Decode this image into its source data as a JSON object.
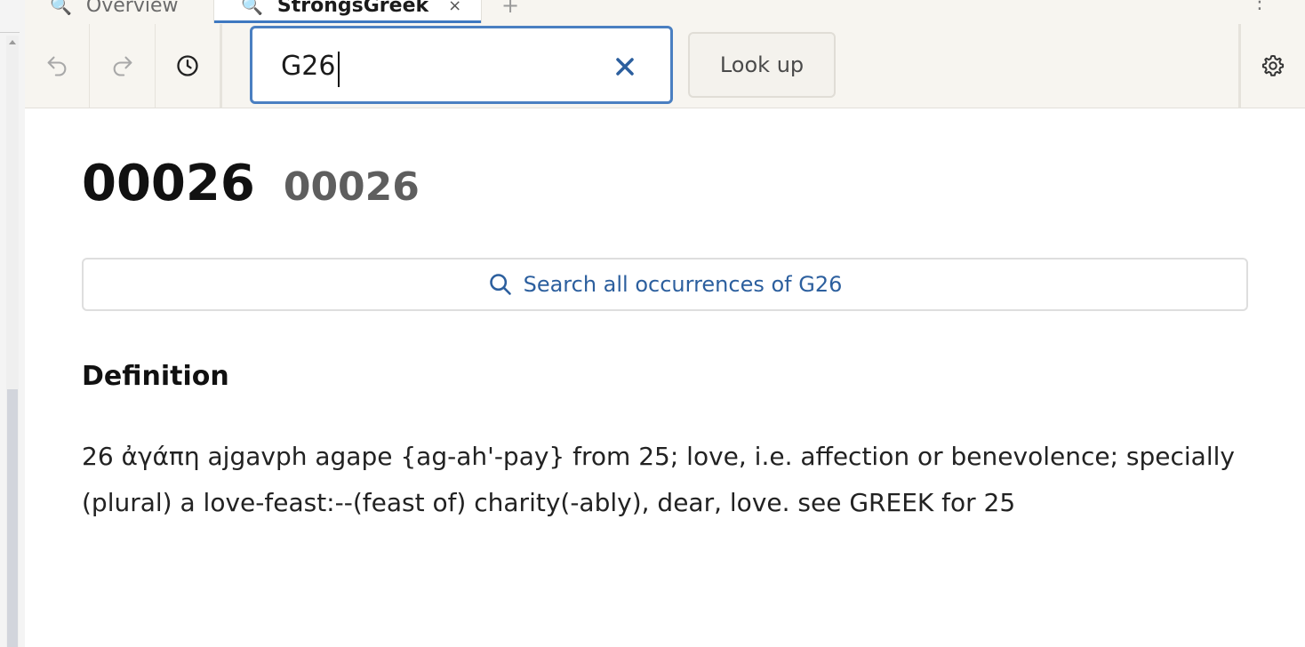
{
  "tabs": [
    {
      "label": "Overview",
      "icon": "search-icon"
    },
    {
      "label": "StrongsGreek",
      "icon": "search-icon",
      "active": true,
      "close_symbol": "×"
    }
  ],
  "new_tab_symbol": "+",
  "tab_menu_symbol": "⋮",
  "toolbar": {
    "undo_icon": "undo-icon",
    "redo_icon": "redo-icon",
    "history_icon": "clock-icon",
    "search_value": "G26",
    "clear_icon": "close-icon",
    "lookup_label": "Look up",
    "settings_icon": "gear-icon"
  },
  "entry": {
    "number": "00026",
    "number_secondary": "00026",
    "search_all_label": "Search all occurrences of G26",
    "definition_heading": "Definition",
    "definition_text": "26 ἀγάπη ajgavph agape {ag-ah'-pay} from 25; love, i.e. affection or benevolence; specially (plural) a love-feast:--(feast of) charity(-ably), dear, love. see GREEK for 25"
  },
  "colors": {
    "accent": "#4a7fc1",
    "link": "#2c5f9e",
    "toolbar_bg": "#f7f5f0",
    "tab_icon": "#7b3fb8"
  }
}
